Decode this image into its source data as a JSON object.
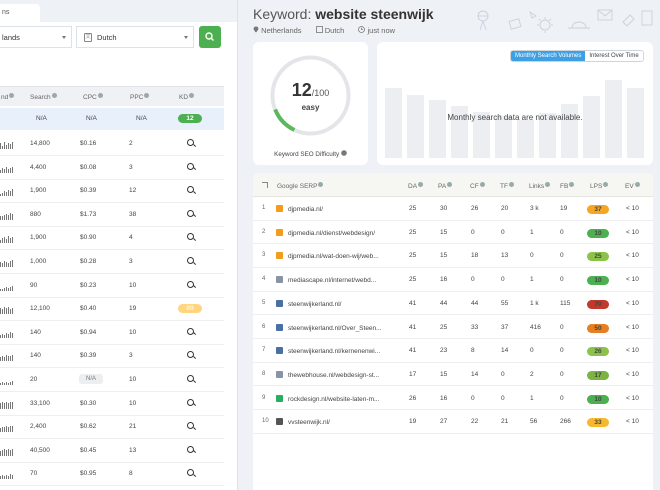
{
  "left_panel": {
    "tab_label": "ns",
    "location_value": "lands",
    "language_value": "Dutch",
    "columns": [
      "nd",
      "Search",
      "CPC",
      "PPC",
      "KD"
    ],
    "highlight_row": {
      "search": "N/A",
      "cpc": "N/A",
      "ppc": "N/A",
      "kd": "12"
    },
    "rows": [
      {
        "search": "14,800",
        "cpc": "$0.16",
        "ppc": "2"
      },
      {
        "search": "4,400",
        "cpc": "$0.08",
        "ppc": "3"
      },
      {
        "search": "1,900",
        "cpc": "$0.39",
        "ppc": "12"
      },
      {
        "search": "880",
        "cpc": "$1.73",
        "ppc": "38"
      },
      {
        "search": "1,900",
        "cpc": "$0.90",
        "ppc": "4"
      },
      {
        "search": "1,000",
        "cpc": "$0.28",
        "ppc": "3"
      },
      {
        "search": "90",
        "cpc": "$0.23",
        "ppc": "10"
      },
      {
        "search": "12,100",
        "cpc": "$0.40",
        "ppc": "19",
        "kd": "89"
      },
      {
        "search": "140",
        "cpc": "$0.94",
        "ppc": "10"
      },
      {
        "search": "140",
        "cpc": "$0.39",
        "ppc": "3"
      },
      {
        "search": "20",
        "cpc": "N/A",
        "ppc": "10"
      },
      {
        "search": "33,100",
        "cpc": "$0.30",
        "ppc": "10"
      },
      {
        "search": "2,400",
        "cpc": "$0.62",
        "ppc": "21"
      },
      {
        "search": "40,500",
        "cpc": "$0.45",
        "ppc": "13"
      },
      {
        "search": "70",
        "cpc": "$0.95",
        "ppc": "8"
      }
    ]
  },
  "header": {
    "keyword_label": "Keyword:",
    "keyword": "website steenwijk",
    "location": "Netherlands",
    "language": "Dutch",
    "updated": "just now"
  },
  "difficulty": {
    "score": 12,
    "max": "/100",
    "label": "easy",
    "caption": "Keyword SEO Difficulty"
  },
  "volume_card": {
    "tab_monthly": "Monthly Search Volumes",
    "tab_interest": "Interest Over Time",
    "message": "Monthly search data are not available."
  },
  "serp": {
    "columns": [
      "Google SERP",
      "DA",
      "PA",
      "CF",
      "TF",
      "Links",
      "FB",
      "LPS",
      "EV"
    ],
    "rows": [
      {
        "n": "1",
        "domain": "djpmedia.nl",
        "path": "/",
        "da": "25",
        "pa": "30",
        "cf": "26",
        "tf": "20",
        "links": "3 k",
        "fb": "19",
        "lps": "37",
        "ev": "< 10",
        "fav": "#f29b1c",
        "lps_color": "#f5a623"
      },
      {
        "n": "2",
        "domain": "djpmedia.nl",
        "path": "/dienst/webdesign/",
        "da": "25",
        "pa": "15",
        "cf": "0",
        "tf": "0",
        "links": "1",
        "fb": "0",
        "lps": "10",
        "ev": "< 10",
        "fav": "#f29b1c",
        "lps_color": "#4caf50"
      },
      {
        "n": "3",
        "domain": "djpmedia.nl",
        "path": "/wat-doen-wij/web...",
        "da": "25",
        "pa": "15",
        "cf": "18",
        "tf": "13",
        "links": "0",
        "fb": "0",
        "lps": "25",
        "ev": "< 10",
        "fav": "#f29b1c",
        "lps_color": "#8bc34a"
      },
      {
        "n": "4",
        "domain": "mediascape.nl",
        "path": "/internet/webd...",
        "da": "25",
        "pa": "16",
        "cf": "0",
        "tf": "0",
        "links": "1",
        "fb": "0",
        "lps": "10",
        "ev": "< 10",
        "fav": "#8894a6",
        "lps_color": "#4caf50"
      },
      {
        "n": "5",
        "domain": "steenwijkerland.nl",
        "path": "/",
        "da": "41",
        "pa": "44",
        "cf": "44",
        "tf": "55",
        "links": "1 k",
        "fb": "115",
        "lps": "70",
        "ev": "< 10",
        "fav": "#4a6fa5",
        "lps_color": "#c0392b"
      },
      {
        "n": "6",
        "domain": "steenwijkerland.nl",
        "path": "/Over_Steen...",
        "da": "41",
        "pa": "25",
        "cf": "33",
        "tf": "37",
        "links": "416",
        "fb": "0",
        "lps": "50",
        "ev": "< 10",
        "fav": "#4a6fa5",
        "lps_color": "#e67e22"
      },
      {
        "n": "7",
        "domain": "steenwijkerland.nl",
        "path": "/kernenenwi...",
        "da": "41",
        "pa": "23",
        "cf": "8",
        "tf": "14",
        "links": "0",
        "fb": "0",
        "lps": "26",
        "ev": "< 10",
        "fav": "#4a6fa5",
        "lps_color": "#8bc34a"
      },
      {
        "n": "8",
        "domain": "thewebhouse.nl",
        "path": "/webdesign-st...",
        "da": "17",
        "pa": "15",
        "cf": "14",
        "tf": "0",
        "links": "2",
        "fb": "0",
        "lps": "17",
        "ev": "< 10",
        "fav": "#8894a6",
        "lps_color": "#7cb342"
      },
      {
        "n": "9",
        "domain": "rockdesign.nl",
        "path": "/website-laten-m...",
        "da": "26",
        "pa": "16",
        "cf": "0",
        "tf": "0",
        "links": "1",
        "fb": "0",
        "lps": "10",
        "ev": "< 10",
        "fav": "#27ae60",
        "lps_color": "#4caf50"
      },
      {
        "n": "10",
        "domain": "vvsteenwijk.nl",
        "path": "/",
        "da": "19",
        "pa": "27",
        "cf": "22",
        "tf": "21",
        "links": "56",
        "fb": "266",
        "lps": "33",
        "ev": "< 10",
        "fav": "#555555",
        "lps_color": "#f5b82e"
      }
    ]
  },
  "colors": {
    "accent": "#3ea0e4",
    "go_button": "#4caf50",
    "link": "#2f7fd1"
  }
}
